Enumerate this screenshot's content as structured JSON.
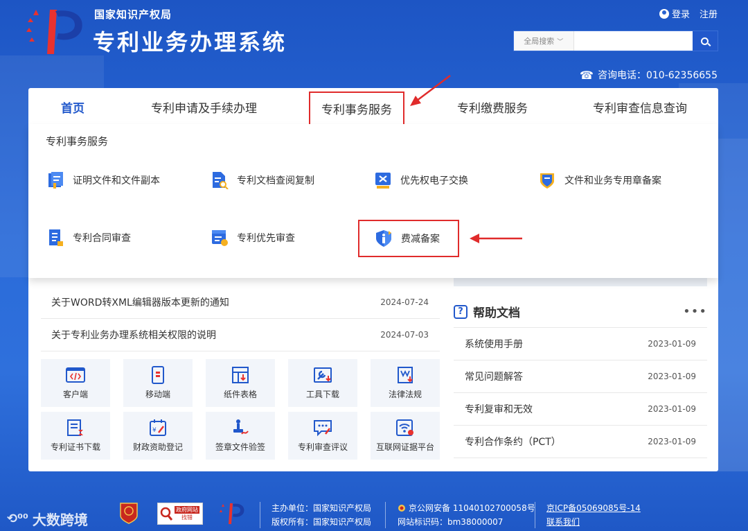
{
  "header": {
    "org_name": "国家知识产权局",
    "system_name": "专利业务办理系统",
    "login_label": "登录",
    "register_label": "注册",
    "search_scope": "全局搜索",
    "search_placeholder": "",
    "phone_label": "咨询电话：010-62356655"
  },
  "nav": {
    "tabs": [
      {
        "label": "首页",
        "active": true
      },
      {
        "label": "专利申请及手续办理",
        "active": false
      },
      {
        "label": "专利事务服务",
        "active": false,
        "highlighted": true
      },
      {
        "label": "专利缴费服务",
        "active": false
      },
      {
        "label": "专利审查信息查询",
        "active": false
      }
    ]
  },
  "dropdown": {
    "title": "专利事务服务",
    "items": [
      {
        "label": "证明文件和文件副本",
        "icon": "certificate-doc-icon"
      },
      {
        "label": "专利文档查阅复制",
        "icon": "doc-search-icon"
      },
      {
        "label": "优先权电子交换",
        "icon": "exchange-icon"
      },
      {
        "label": "文件和业务专用章备案",
        "icon": "shield-stamp-icon"
      },
      {
        "label": "专利合同审查",
        "icon": "contract-icon"
      },
      {
        "label": "专利优先审查",
        "icon": "priority-review-icon"
      },
      {
        "label": "费减备案",
        "icon": "info-shield-icon",
        "highlighted": true
      }
    ]
  },
  "news": [
    {
      "title": "关于WORD转XML编辑器版本更新的通知",
      "date": "2024-07-24"
    },
    {
      "title": "关于专利业务办理系统相关权限的说明",
      "date": "2024-07-03"
    }
  ],
  "tools": [
    {
      "label": "客户端",
      "icon": "code-window-icon"
    },
    {
      "label": "移动端",
      "icon": "mobile-icon"
    },
    {
      "label": "纸件表格",
      "icon": "form-download-icon"
    },
    {
      "label": "工具下载",
      "icon": "wrench-download-icon"
    },
    {
      "label": "法律法规",
      "icon": "law-book-icon"
    },
    {
      "label": "专利证书下载",
      "icon": "certificate-download-icon"
    },
    {
      "label": "财政资助登记",
      "icon": "funding-icon"
    },
    {
      "label": "签章文件验签",
      "icon": "stamp-verify-icon"
    },
    {
      "label": "专利审查评议",
      "icon": "review-comment-icon"
    },
    {
      "label": "互联网证据平台",
      "icon": "evidence-platform-icon"
    }
  ],
  "help": {
    "title": "帮助文档",
    "more": "•••",
    "items": [
      {
        "title": "系统使用手册",
        "date": "2023-01-09"
      },
      {
        "title": "常见问题解答",
        "date": "2023-01-09"
      },
      {
        "title": "专利复审和无效",
        "date": "2023-01-09"
      },
      {
        "title": "专利合作条约（PCT）",
        "date": "2023-01-09"
      }
    ]
  },
  "footer": {
    "sponsor": "主办单位：国家知识产权局",
    "copyright": "版权所有：国家知识产权局",
    "police": "京公网安备 11040102700058号",
    "site_id": "网站标识码：bm38000007",
    "icp": "京ICP备05069085号-14",
    "contact": "联系我们",
    "gov_badge_top": "政府网站",
    "gov_badge_bottom": "找错",
    "watermark": "大数跨境"
  },
  "colors": {
    "primary": "#2158cb",
    "highlight_red": "#e02b2b",
    "background_blue": "#2a6bd9"
  }
}
